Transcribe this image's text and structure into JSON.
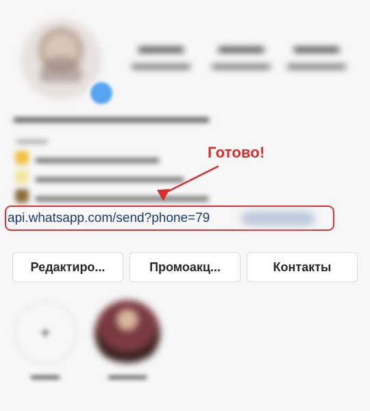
{
  "annotation": {
    "text": "Готово!",
    "color": "#d62d2d"
  },
  "profile": {
    "link": {
      "visible_text": "api.whatsapp.com/send?phone=79",
      "frame_color": "#e03137",
      "text_color": "#1a3b6e"
    }
  },
  "buttons": {
    "edit": "Редактиро...",
    "promo": "Промоакц...",
    "contacts": "Контакты"
  },
  "icons": {
    "verified": "verified-check-icon",
    "new_highlight": "plus-icon",
    "annotation_arrow": "arrow-icon"
  },
  "colors": {
    "background": "#f7f7f7",
    "button_border": "#dbdbdb",
    "verified_badge": "#57a5f1"
  }
}
